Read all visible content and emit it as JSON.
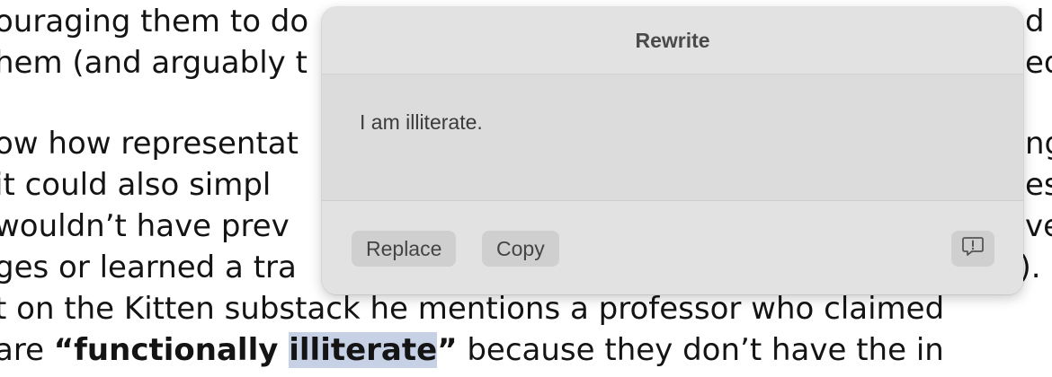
{
  "document": {
    "line1": "ouraging them to do",
    "line1_right": "d",
    "line2": "hem (and arguably t",
    "line2_right": "ed",
    "line3": "ow how representat",
    "line3_right": "ng",
    "line4": " it could also simpl",
    "line4_right": "es",
    "line5": " wouldn’t have prev",
    "line5_right": "ve",
    "line6": "ges or learned a tra",
    "line6_right": "l).",
    "line7": "t on the Kitten substack he mentions a professor who claimed",
    "line8_prefix": " are ",
    "line8_bold_open": "“functionally ",
    "line8_highlight": "illiterate",
    "line8_bold_close": "”",
    "line8_suffix": " because they don’t have the in"
  },
  "popover": {
    "title": "Rewrite",
    "result": "I am illiterate.",
    "replace_label": "Replace",
    "copy_label": "Copy",
    "feedback_icon": "feedback-exclamation-bubble-icon"
  }
}
